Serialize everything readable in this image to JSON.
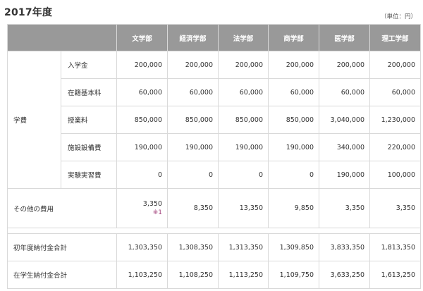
{
  "title": "2017年度",
  "unit": "（単位：円）",
  "columns": [
    "文学部",
    "経済学部",
    "法学部",
    "商学部",
    "医学部",
    "理工学部"
  ],
  "tuition": {
    "label": "学費",
    "rows": [
      {
        "label": "入学金",
        "values": [
          "200,000",
          "200,000",
          "200,000",
          "200,000",
          "200,000",
          "200,000"
        ]
      },
      {
        "label": "在籍基本料",
        "values": [
          "60,000",
          "60,000",
          "60,000",
          "60,000",
          "60,000",
          "60,000"
        ]
      },
      {
        "label": "授業料",
        "values": [
          "850,000",
          "850,000",
          "850,000",
          "850,000",
          "3,040,000",
          "1,230,000"
        ]
      },
      {
        "label": "施設設備費",
        "values": [
          "190,000",
          "190,000",
          "190,000",
          "190,000",
          "340,000",
          "220,000"
        ]
      },
      {
        "label": "実験実習費",
        "values": [
          "0",
          "0",
          "0",
          "0",
          "190,000",
          "100,000"
        ]
      }
    ]
  },
  "other": {
    "label": "その他の費用",
    "values": [
      "3,350",
      "8,350",
      "13,350",
      "9,850",
      "3,350",
      "3,350"
    ],
    "note": "※1"
  },
  "totals": [
    {
      "label": "初年度納付金合計",
      "values": [
        "1,303,350",
        "1,308,350",
        "1,313,350",
        "1,309,850",
        "3,833,350",
        "1,813,350"
      ]
    },
    {
      "label": "在学生納付金合計",
      "values": [
        "1,103,250",
        "1,108,250",
        "1,113,250",
        "1,109,750",
        "3,633,250",
        "1,613,250"
      ]
    }
  ]
}
